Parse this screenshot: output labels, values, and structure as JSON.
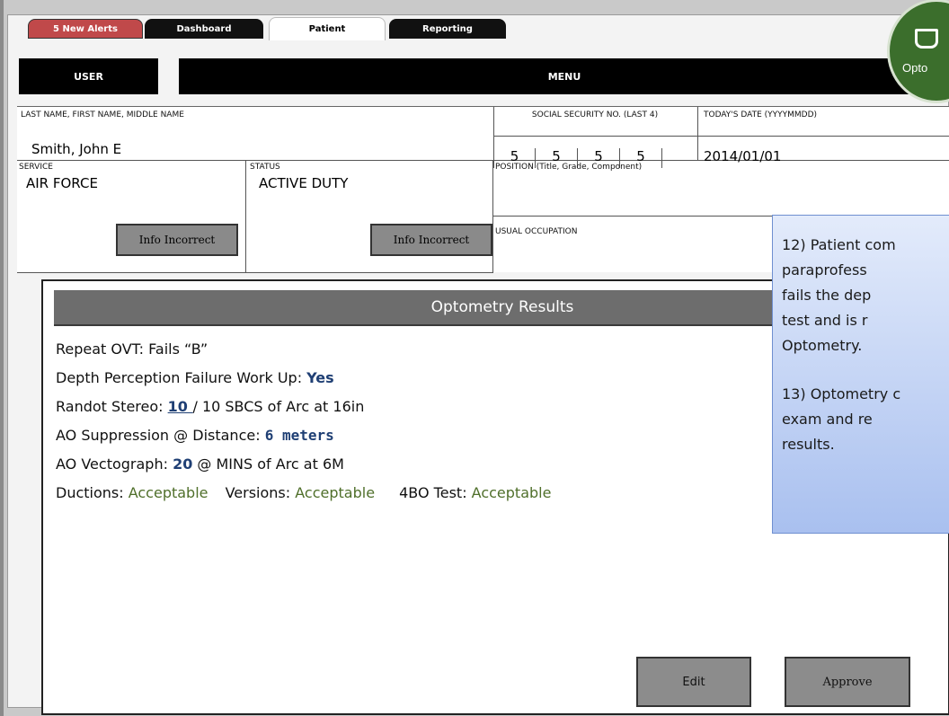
{
  "tabs": {
    "alerts": "5 New Alerts",
    "dashboard": "Dashboard",
    "patient": "Patient",
    "reporting": "Reporting"
  },
  "menu": {
    "user": "USER",
    "menu": "MENU"
  },
  "badge": {
    "label": "Opto"
  },
  "form": {
    "name_label": "LAST NAME, FIRST NAME, MIDDLE NAME",
    "name_value": "Smith, John E",
    "ssn_label": "SOCIAL SECURITY NO. (LAST 4)",
    "ssn_digits": [
      "5",
      "5",
      "5",
      "5"
    ],
    "date_label": "TODAY'S DATE (YYYYMMDD)",
    "date_value": "2014/01/01",
    "service_label": "SERVICE",
    "service_value": "AIR FORCE",
    "status_label": "STATUS",
    "status_value": "ACTIVE DUTY",
    "position_label": "POSITION (Title, Grade, Component)",
    "occupation_label": "USUAL OCCUPATION",
    "info_incorrect_1": "Info Incorrect",
    "info_incorrect_2": "Info Incorrect"
  },
  "results": {
    "title": "Optometry Results",
    "ovt_label": "Repeat OVT: Fails “B”",
    "depth_label": "Depth Perception Failure Work Up: ",
    "depth_value": "Yes",
    "randot_label": "Randot Stereo: ",
    "randot_value": "10 ",
    "randot_rest": "/ 10   SBCS of Arc at 16in",
    "ao_supp_label": "AO Suppression @ Distance: ",
    "ao_supp_value": "6 meters",
    "ao_vecto_label": "AO Vectograph: ",
    "ao_vecto_value": "20",
    "ao_vecto_rest": " @ MINS of Arc at 6M",
    "ductions_label": "Ductions: ",
    "ductions_value": "Acceptable",
    "versions_label": "Versions: ",
    "versions_value": "Acceptable",
    "bo_label": "4BO Test: ",
    "bo_value": "Acceptable",
    "edit_label": "Edit",
    "approve_label": "Approve"
  },
  "note": {
    "lines": [
      "12) Patient com",
      "      paraprofess",
      "      fails the dep",
      "      test and is r",
      "      Optometry.",
      "",
      "13) Optometry c",
      "      exam and re",
      "      results."
    ]
  }
}
